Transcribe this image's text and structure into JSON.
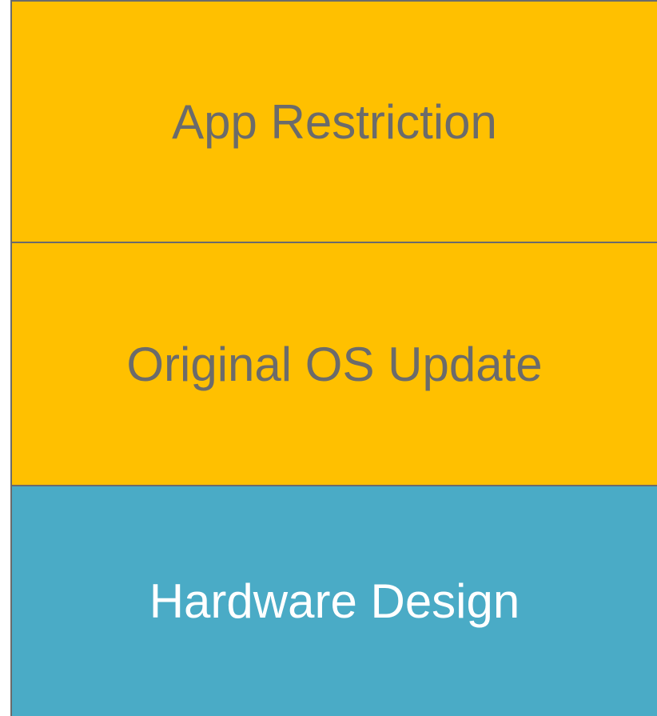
{
  "layers": [
    {
      "label": "App Restriction",
      "fill": "#ffc000",
      "text_color": "#6b6b6b"
    },
    {
      "label": "Original OS Update",
      "fill": "#ffc000",
      "text_color": "#6b6b6b"
    },
    {
      "label": "Hardware Design",
      "fill": "#4aabc6",
      "text_color": "#ffffff"
    }
  ],
  "colors": {
    "border": "#6b6b6b",
    "background": "#ffffff"
  }
}
